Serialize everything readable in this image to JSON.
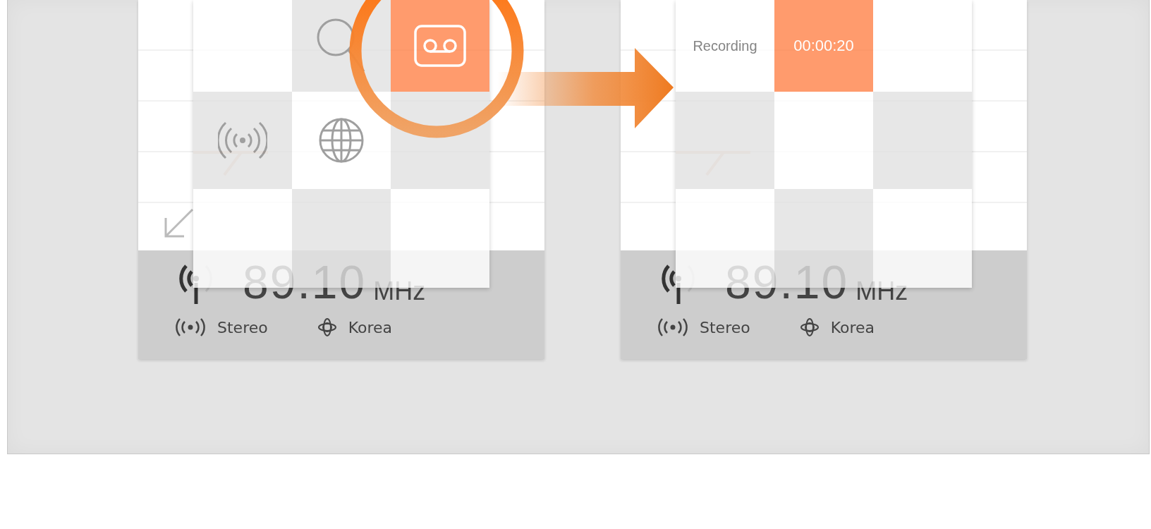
{
  "panels": [
    {
      "tiles": [
        {
          "kind": "blank",
          "selected": false
        },
        {
          "kind": "search",
          "selected": false
        },
        {
          "kind": "record",
          "selected": true
        },
        {
          "kind": "broadcast",
          "selected": false
        },
        {
          "kind": "globe",
          "selected": false
        },
        {
          "kind": "blank",
          "selected": false
        },
        {
          "kind": "blank",
          "selected": false
        },
        {
          "kind": "blank",
          "selected": false
        },
        {
          "kind": "blank",
          "selected": false
        }
      ],
      "frequency": "89.10",
      "unit": "MHz",
      "audio_mode": "Stereo",
      "region": "Korea",
      "corner_control": true
    },
    {
      "tiles": [
        {
          "kind": "label",
          "text": "Recording",
          "selected": false
        },
        {
          "kind": "timer",
          "text": "00:00:20",
          "selected": true
        },
        {
          "kind": "blank",
          "selected": false
        },
        {
          "kind": "blank",
          "selected": false
        },
        {
          "kind": "blank",
          "selected": false
        },
        {
          "kind": "blank",
          "selected": false
        },
        {
          "kind": "blank",
          "selected": false
        },
        {
          "kind": "blank",
          "selected": false
        },
        {
          "kind": "blank",
          "selected": false
        }
      ],
      "frequency": "89.10",
      "unit": "MHz",
      "audio_mode": "Stereo",
      "region": "Korea",
      "corner_control": false
    }
  ]
}
